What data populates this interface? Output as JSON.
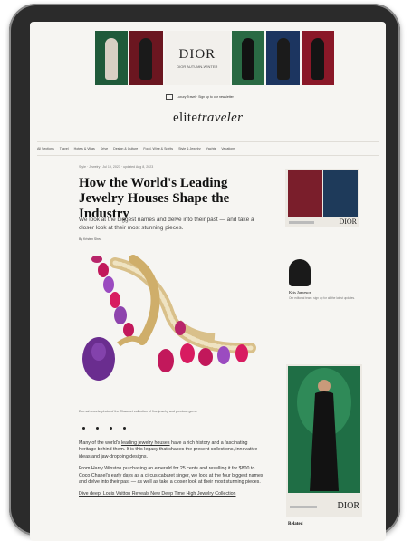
{
  "ad_top": {
    "brand": "DIOR",
    "tagline": "DIOR AUTUMN-WINTER",
    "tile_colors": [
      "#1f5a3a",
      "#6b1620",
      "#1c3560",
      "#2a6a44",
      "#8a1828"
    ]
  },
  "header": {
    "signup_text": "Luxury Travel · Sign up to our newsletter",
    "logo_prefix": "elite",
    "logo_script": "traveler"
  },
  "nav": {
    "items": [
      "All Sections",
      "Travel",
      "Hotels & Villas",
      "Drive",
      "Design & Culture",
      "Food, Wine & Spirits",
      "Style & Jewelry",
      "Yachts",
      "Vacations"
    ]
  },
  "article": {
    "crumbs": "Style · Jewelry | Jul 19, 2023 · updated Aug 8, 2023",
    "headline": "How the World's Leading Jewelry Houses Shape the Industry",
    "dek": "We look at the biggest names and delve into their past — and take a closer look at their most stunning pieces.",
    "byline": "By Kristen Shea",
    "caption": "Eternal Jewels: photo of the Chaumet collection of fine jewelry and precious gems.",
    "para1_a": "Many of the world's ",
    "para1_link": "leading jewelry houses",
    "para1_b": " have a rich history and a fascinating heritage behind them. It is this legacy that shapes the present collections, innovative ideas and jaw-dropping designs.",
    "para2": "From Harry Winston purchasing an emerald for 25 cents and reselling it for $800 to Coco Chanel's early days as a circus cabaret singer, we look at the four biggest names and delve into their past — as well as take a closer look at their most stunning pieces.",
    "para3": "Dive deep: Louis Vuitton Reveals New Deep Time High Jewelry Collection"
  },
  "sidebar": {
    "ad_brand": "DIOR",
    "author_name": "Kris Jameson",
    "author_note": "Our editorial team: sign up for all the latest updates.",
    "ad2_brand": "DIOR",
    "related": "Related"
  },
  "colors": {
    "screen_bg": "#f6f5f2",
    "ink": "#111111",
    "ruby": "#c2185b",
    "amethyst": "#8e44ad",
    "gold": "#c9a55a"
  }
}
